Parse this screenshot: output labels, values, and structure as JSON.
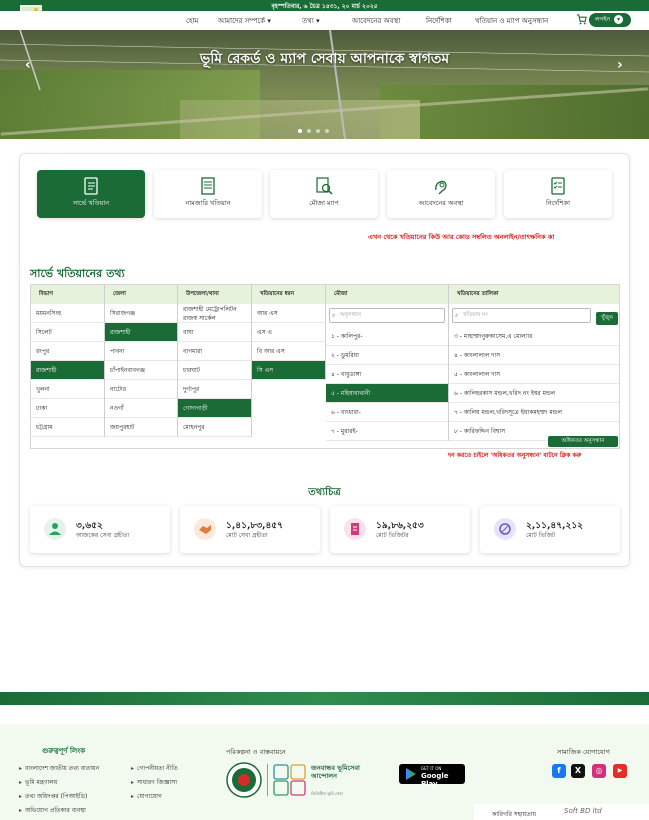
{
  "topbar": {
    "date": "বৃহস্পতিবার, ৬ চৈত্র ১৪৩১, ২০ মার্চ ২০২৫"
  },
  "nav": {
    "home": "হোম",
    "about": "আমাদের সম্পর্কে",
    "info": "তথ্য",
    "application_status": "আবেদনের অবস্থা",
    "guide": "নির্দেশিকা",
    "search": "খতিয়ান ও ম্যাপ অনুসন্ধান",
    "login": "লগইন"
  },
  "hero": {
    "title": "ভূমি রেকর্ড ও ম্যাপ সেবায় আপনাকে স্বাগতম",
    "prev": "‹",
    "next": "›"
  },
  "tabs": [
    {
      "label": "সার্ভে খতিয়ান",
      "icon": "document-list-icon"
    },
    {
      "label": "নামজারি খতিয়ান",
      "icon": "ledger-icon"
    },
    {
      "label": "মৌজা ম্যাপ",
      "icon": "map-search-icon"
    },
    {
      "label": "আবেদনের অবস্থা",
      "icon": "hand-status-icon"
    },
    {
      "label": "নির্দেশিকা",
      "icon": "checklist-icon"
    }
  ],
  "marquee": "এখন থেকে খতিয়ানের কিউ আর কোড সম্বলিত অনলাইন/তাৎক্ষনিক কা",
  "section_title": "সার্ভে খতিয়ানের তথ্য",
  "grid": {
    "headers": [
      "বিভাগ",
      "জেলা",
      "উপজেলা/থানা",
      "খতিয়ানের ধরন",
      "মৌজা",
      "খতিয়ানের তালিকা"
    ],
    "division": [
      "ময়মনসিংহ",
      "সিলেট",
      "রংপুর",
      "রাজশাহী",
      "খুলনা",
      "ঢাকা",
      "চট্টগ্রাম"
    ],
    "district": [
      "সিরাজগঞ্জ",
      "রাজশাহী",
      "পাবনা",
      "চাঁপাইনবাবগঞ্জ",
      "নাটোর",
      "নওগাঁ",
      "জয়পুরহাট"
    ],
    "upazila": [
      "রাজশাহী মেট্রোপলিটন রাজস্ব সার্কেল",
      "বাঘা",
      "বাগমারা",
      "চারঘাট",
      "দুর্গাপুর",
      "গোদাগাড়ী",
      "মোহনপুর"
    ],
    "khatian_type": [
      "আর এস",
      "এস এ",
      "বি আর এস",
      "সি এস"
    ],
    "mouza_placeholder": "অনুসন্ধান",
    "mouza": [
      "১ - কালিপুর-",
      "২ - ডুমরিয়া",
      "৪ - বাবুডাঙ্গা",
      "৫ - মহিষাবাথানী",
      "৬ - বাংধারা-",
      "৭ - মুরারই-"
    ],
    "khatian_placeholder": "খতিয়ান নং",
    "search_btn": "খুঁজুন",
    "khatian": [
      "৩ - মাহাম্মদনুরুকাসেম,এ মোল্যার",
      "৪ - কাংলালাল দাস",
      "৫ - কাংলালাল দাস",
      "৬ - কালিহরকাস মন্ডল,খরিদ নং ইশ্বর মন্ডল",
      "৭ - কালিয় মন্ডল,খরিদসূত্রে ইয়াকমহম্মদ মন্ডল",
      "৮ - কারিফদ্দিন বিশ্বাস"
    ],
    "more_btn": "অধিকতর অনুসন্ধান"
  },
  "note": "দন করতে চাইলে 'অধিকতর অনুসন্ধান' বাটনে ক্লিক করু",
  "info_title": "তথ্যচিত্র",
  "stats": [
    {
      "value": "৩,৬৫২",
      "label": "আজকের সেবা গ্রহীতা",
      "color": "#2e9e5b"
    },
    {
      "value": "১,৪১,৮৩,৪৫৭",
      "label": "মোট সেবা গ্রহীতা",
      "color": "#e07a3a"
    },
    {
      "value": "১৯,৮৬,২৫৩",
      "label": "মোট ভিজিটর",
      "color": "#d23a7d"
    },
    {
      "value": "২,১১,৪৭,২১২",
      "label": "মোট ভিজিট",
      "color": "#6a56c8"
    }
  ],
  "footer": {
    "links_title": "গুরুত্বপূর্ণ লিংক",
    "links_left": [
      "বাংলাদেশ জাতীয় তথ্য বাতায়ন",
      "ভূমি মন্ত্রণালয়",
      "তথ্য অধিদপ্তর (পিআইডি)",
      "অভিযোগ প্রতিকার ব্যবস্থা"
    ],
    "links_right": [
      "গোপনীয়তা নীতি",
      "সাধারণ জিজ্ঞাসা",
      "যোগাযোগ"
    ],
    "plan_title": "পরিকল্পনা ও বাস্তবায়নে",
    "service_name": "জনবান্ধব ভূমিসেবা আন্দোলন",
    "service_tag": "ডিজিটাল ভূমি সেবা",
    "gplay_small": "GET IT ON",
    "gplay_big": "Google Play",
    "social_title": "সামাজিক যোগাযোগ",
    "tech_label": "কারিগরি সহায়তায়",
    "tech_brand": "Soft BD ltd"
  }
}
